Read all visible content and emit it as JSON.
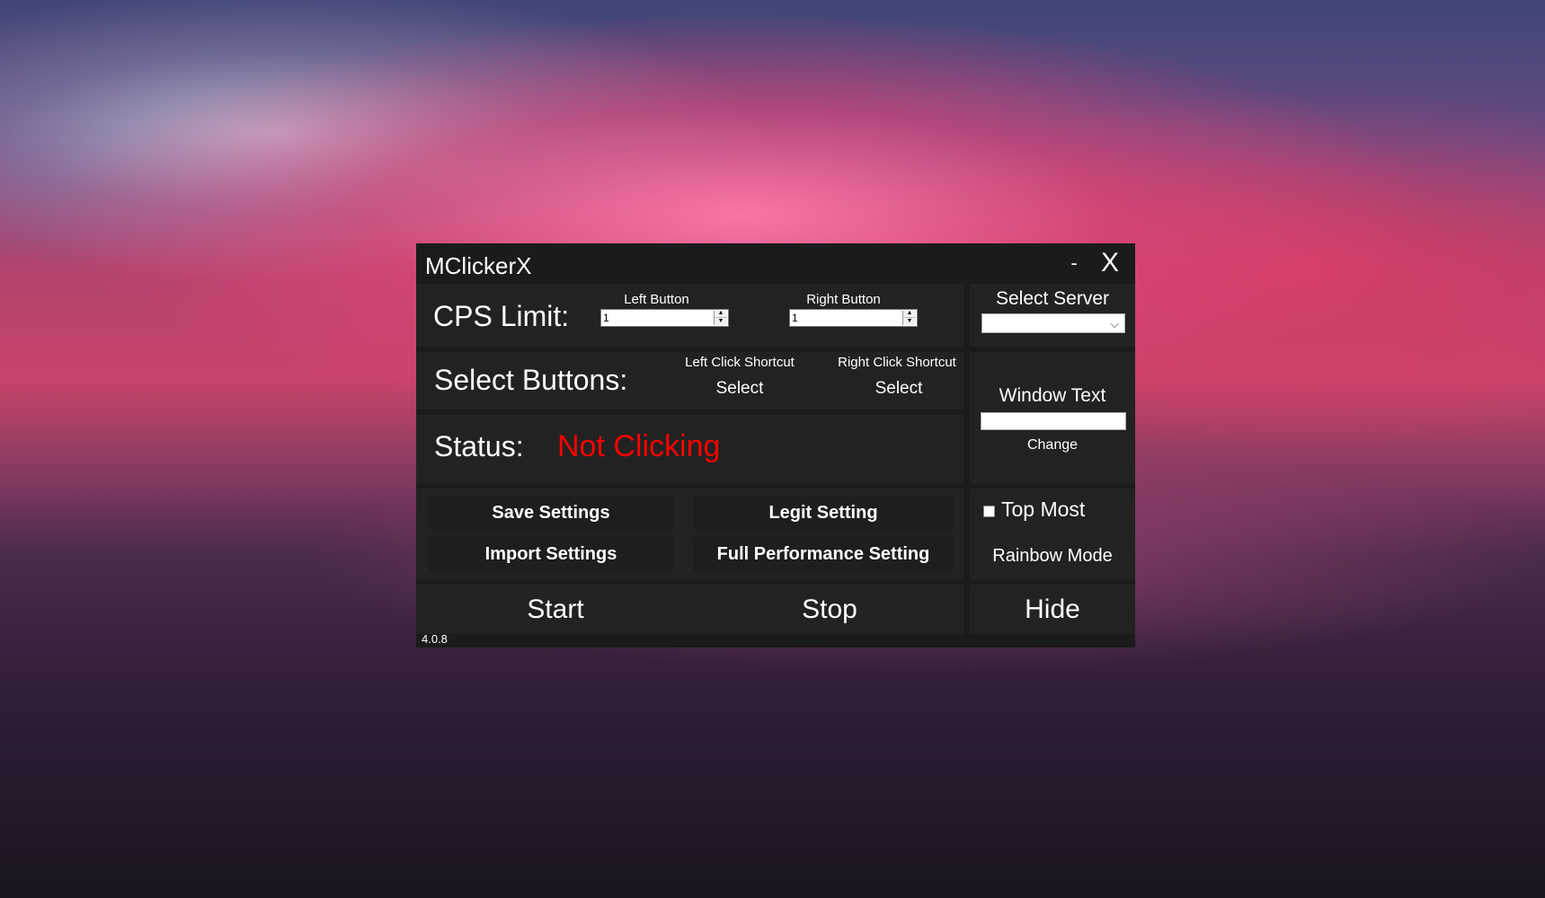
{
  "window": {
    "title": "MClickerX",
    "minimize_label": "-",
    "close_label": "X",
    "version": "4.0.8"
  },
  "cps": {
    "label": "CPS Limit:",
    "left_button_label": "Left Button",
    "left_button_value": "1",
    "right_button_label": "Right Button",
    "right_button_value": "1"
  },
  "server": {
    "label": "Select Server",
    "selected": ""
  },
  "select_buttons": {
    "label": "Select Buttons:",
    "left_shortcut_label": "Left Click Shortcut",
    "left_select": "Select",
    "right_shortcut_label": "Right Click Shortcut",
    "right_select": "Select"
  },
  "window_text": {
    "label": "Window Text",
    "value": "",
    "change_label": "Change"
  },
  "status": {
    "label": "Status:",
    "value": "Not Clicking",
    "value_color": "#ff0000"
  },
  "settings": {
    "save": "Save Settings",
    "import": "Import Settings",
    "legit": "Legit Setting",
    "full_performance": "Full Performance Setting"
  },
  "options": {
    "top_most_label": "Top Most",
    "top_most_checked": false,
    "rainbow_mode": "Rainbow Mode"
  },
  "controls": {
    "start": "Start",
    "stop": "Stop",
    "hide": "Hide"
  }
}
